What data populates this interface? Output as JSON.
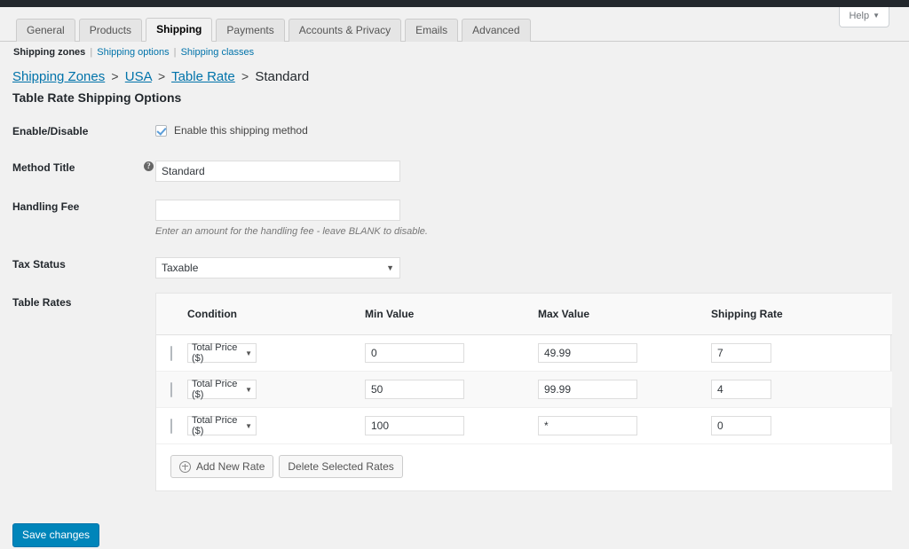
{
  "admin": {
    "help_label": "Help",
    "help_caret": "▼"
  },
  "tabs": [
    {
      "label": "General",
      "active": false
    },
    {
      "label": "Products",
      "active": false
    },
    {
      "label": "Shipping",
      "active": true
    },
    {
      "label": "Payments",
      "active": false
    },
    {
      "label": "Accounts & Privacy",
      "active": false
    },
    {
      "label": "Emails",
      "active": false
    },
    {
      "label": "Advanced",
      "active": false
    }
  ],
  "subnav": {
    "current": "Shipping zones",
    "sep": "|",
    "links": [
      "Shipping options",
      "Shipping classes"
    ]
  },
  "breadcrumb": {
    "sep": ">",
    "links": [
      "Shipping Zones",
      "USA",
      "Table Rate"
    ],
    "current": "Standard"
  },
  "page_title": "Table Rate Shipping Options",
  "fields": {
    "enable": {
      "label": "Enable/Disable",
      "checkbox_label": "Enable this shipping method",
      "checked": true
    },
    "method_title": {
      "label": "Method Title",
      "value": "Standard",
      "placeholder": "",
      "tip": "?"
    },
    "handling_fee": {
      "label": "Handling Fee",
      "value": "",
      "placeholder": "",
      "description": "Enter an amount for the handling fee - leave BLANK to disable."
    },
    "tax_status": {
      "label": "Tax Status",
      "value": "Taxable",
      "caret": "▼"
    },
    "table_rates": {
      "label": "Table Rates"
    }
  },
  "rates_table": {
    "headers": [
      "",
      "Condition",
      "Min Value",
      "Max Value",
      "Shipping Rate"
    ],
    "rows": [
      {
        "selected": false,
        "condition": "Total Price ($)",
        "min": "0",
        "max": "49.99",
        "rate": "7"
      },
      {
        "selected": false,
        "condition": "Total Price ($)",
        "min": "50",
        "max": "99.99",
        "rate": "4"
      },
      {
        "selected": false,
        "condition": "Total Price ($)",
        "min": "100",
        "max": "*",
        "rate": "0"
      }
    ],
    "caret": "▼",
    "add_button": "Add New Rate",
    "delete_button": "Delete Selected Rates"
  },
  "save_label": "Save changes",
  "colors": {
    "accent": "#0085ba",
    "link": "#0073aa",
    "page_bg": "#f1f1f1",
    "admin_bar": "#23282d"
  }
}
